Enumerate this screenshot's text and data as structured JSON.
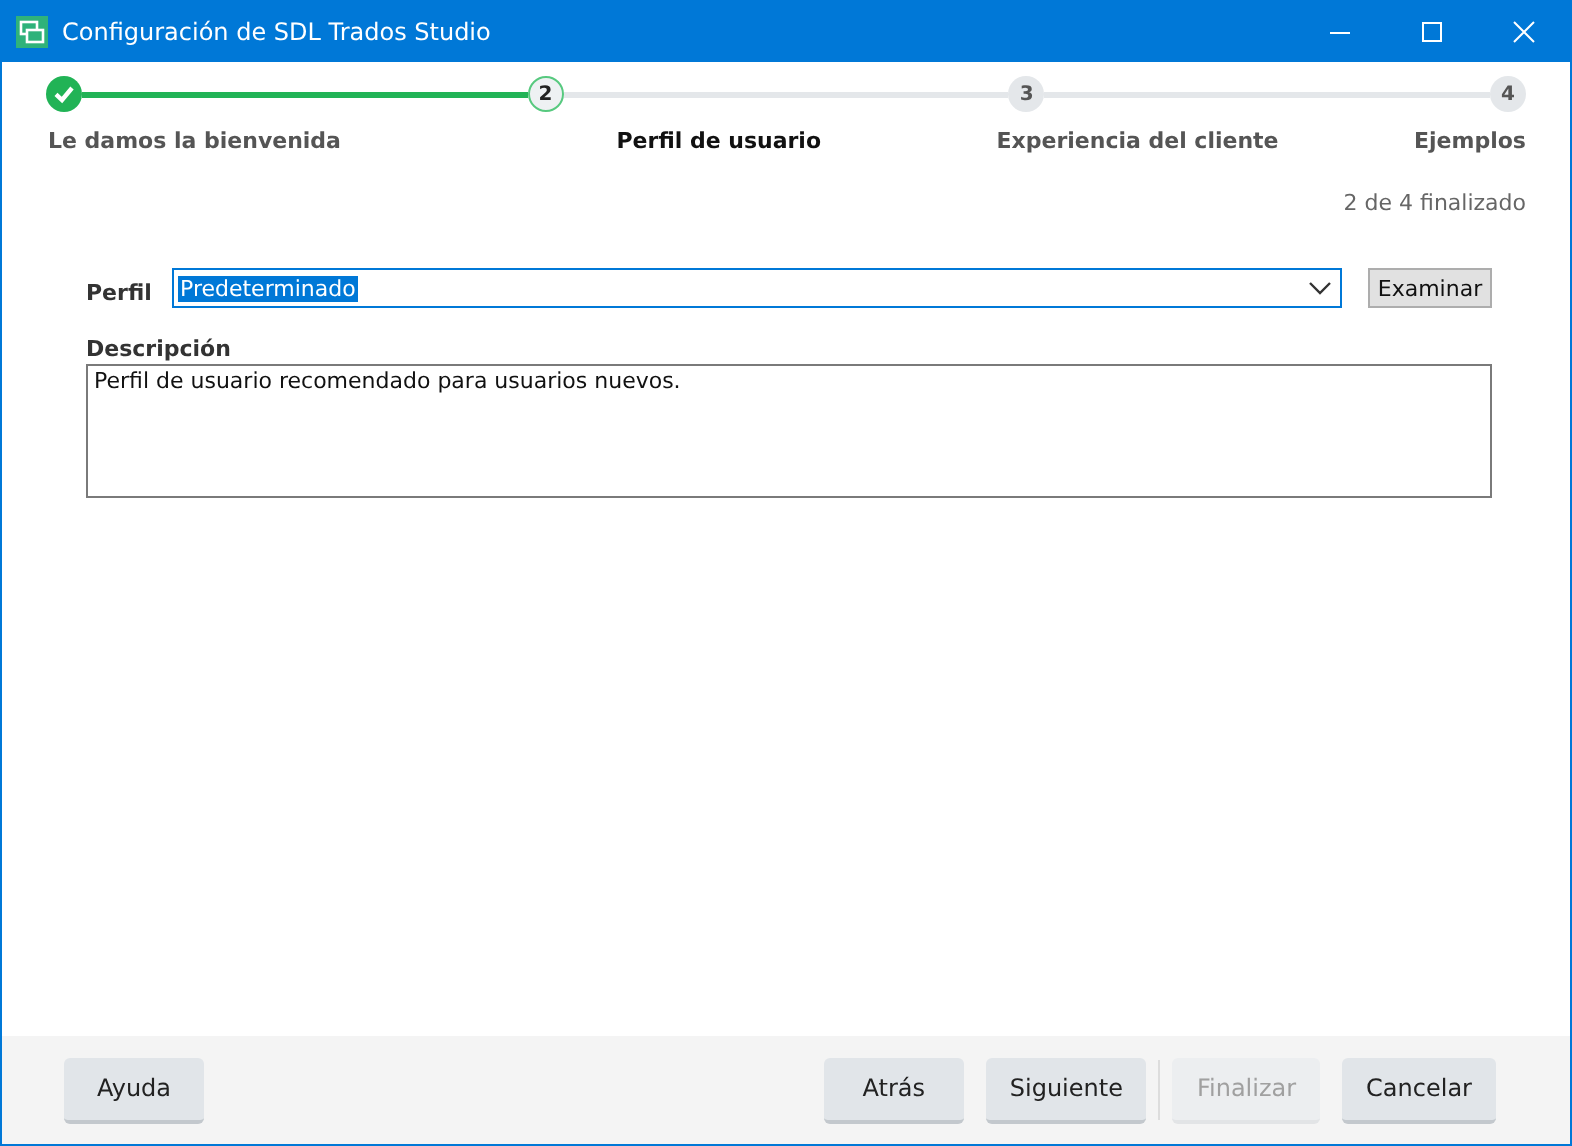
{
  "window": {
    "title": "Configuración de SDL Trados Studio"
  },
  "steps": [
    {
      "label": "Le damos la bienvenida",
      "completed": true,
      "selected": false
    },
    {
      "number": "2",
      "label": "Perfil de usuario",
      "completed": false,
      "selected": true
    },
    {
      "number": "3",
      "label": "Experiencia del cliente",
      "completed": false,
      "selected": false
    },
    {
      "number": "4",
      "label": "Ejemplos",
      "completed": false,
      "selected": false
    }
  ],
  "progress": "2 de 4 finalizado",
  "profile": {
    "label": "Perfil",
    "value": "Predeterminado",
    "browse": "Examinar"
  },
  "description": {
    "label": "Descripción",
    "value": "Perfil de usuario recomendado para usuarios nuevos."
  },
  "left_buttons": [
    {
      "label": "Ayuda",
      "disabled": false
    }
  ],
  "right_buttons": [
    {
      "label": "Atrás",
      "disabled": false
    },
    {
      "label": "Siguiente",
      "disabled": false
    },
    {
      "label": "Finalizar",
      "disabled": true
    },
    {
      "label": "Cancelar",
      "disabled": false
    }
  ]
}
